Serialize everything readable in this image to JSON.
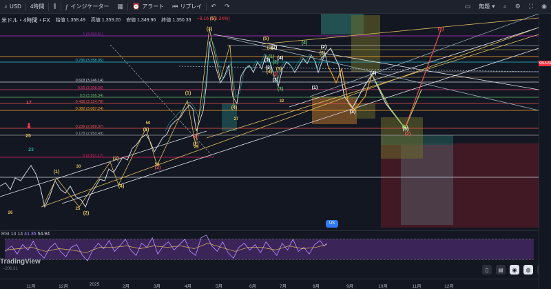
{
  "toolbar": {
    "symbol": "USD",
    "interval": "4時間",
    "indicators_label": "インジケーター",
    "alert_label": "アラート",
    "replay_label": "リプレイ",
    "undo_icon": "undo-icon",
    "redo_icon": "redo-icon",
    "unnamed_label": "無題"
  },
  "legend": {
    "symbol_name": "米ドル・4時間・FX",
    "open": "始値 1,358.49",
    "high": "高値 1,359.20",
    "low": "安値 1,349.96",
    "close": "終値 1,350.33",
    "change": "−8.16 (−0.24%)"
  },
  "price_tag": "XAUUSD",
  "fib_levels": [
    {
      "label": "1 (3,500.51)",
      "color": "#9c27b0"
    },
    {
      "label": "0.786 (3,358.05)",
      "color": "#26c6da"
    },
    {
      "label": "0.618 (3,246.14)",
      "color": "#d1d4dc"
    },
    {
      "label": "0.56 (3,208.56)",
      "color": "#ec407a"
    },
    {
      "label": "0.5 (3,166.34)",
      "color": "#66bb6a"
    },
    {
      "label": "0.438 (3,124.78)",
      "color": "#ef5350"
    },
    {
      "label": "0.382 (3,087.24)",
      "color": "#ffa726"
    },
    {
      "label": "0.236 (2,989.37)",
      "color": "#ef5350"
    },
    {
      "label": "0.178 (2,950.49)",
      "color": "#9e9e9e"
    },
    {
      "label": "0 (2,831.17)",
      "color": "#e91e63"
    }
  ],
  "wave_labels": {
    "yellow": [
      "(1)",
      "(2)",
      "(3)",
      "(4)",
      "(5)",
      "(1)",
      "(2)",
      "(3)",
      "(4)",
      "(5)",
      "(4)",
      "(3)",
      "(1)",
      "(2)",
      "(3)",
      "(4)",
      "(5)"
    ],
    "white": [
      "(1)",
      "(2)",
      "(3)",
      "(4)",
      "(3)",
      "(1)",
      "(2)",
      "(4)",
      "(3)",
      "(5)"
    ],
    "green": [
      "(1)",
      "(2)",
      "(3)",
      "(4)",
      "(5)"
    ],
    "red": [
      "(5)",
      "(2)",
      "(3)"
    ]
  },
  "counts": {
    "red_17": "17",
    "yellow_25": "25",
    "green_23": "23",
    "n26": "26",
    "n25b": "25",
    "n30": "30",
    "n50a": "50",
    "n50b": "50",
    "n27": "27",
    "n32": "32",
    "n25c": "25"
  },
  "rsi": {
    "label": "RSI 14 14",
    "value1": "41.35",
    "value2": "54.94"
  },
  "watermark": "TradingView",
  "watermark_sub": "−206.31",
  "time_axis": [
    "11月",
    "12月",
    "2025",
    "2月",
    "3月",
    "4月",
    "5月",
    "6月",
    "7月",
    "8月",
    "9月",
    "10月",
    "11月",
    "12月"
  ],
  "flag_label": "US",
  "nav_icons": [
    "bookmark-icon",
    "calendar-icon",
    "chat-icon",
    "magnet-icon",
    "eye-icon",
    "chevron-left-icon",
    "coin-icon"
  ]
}
